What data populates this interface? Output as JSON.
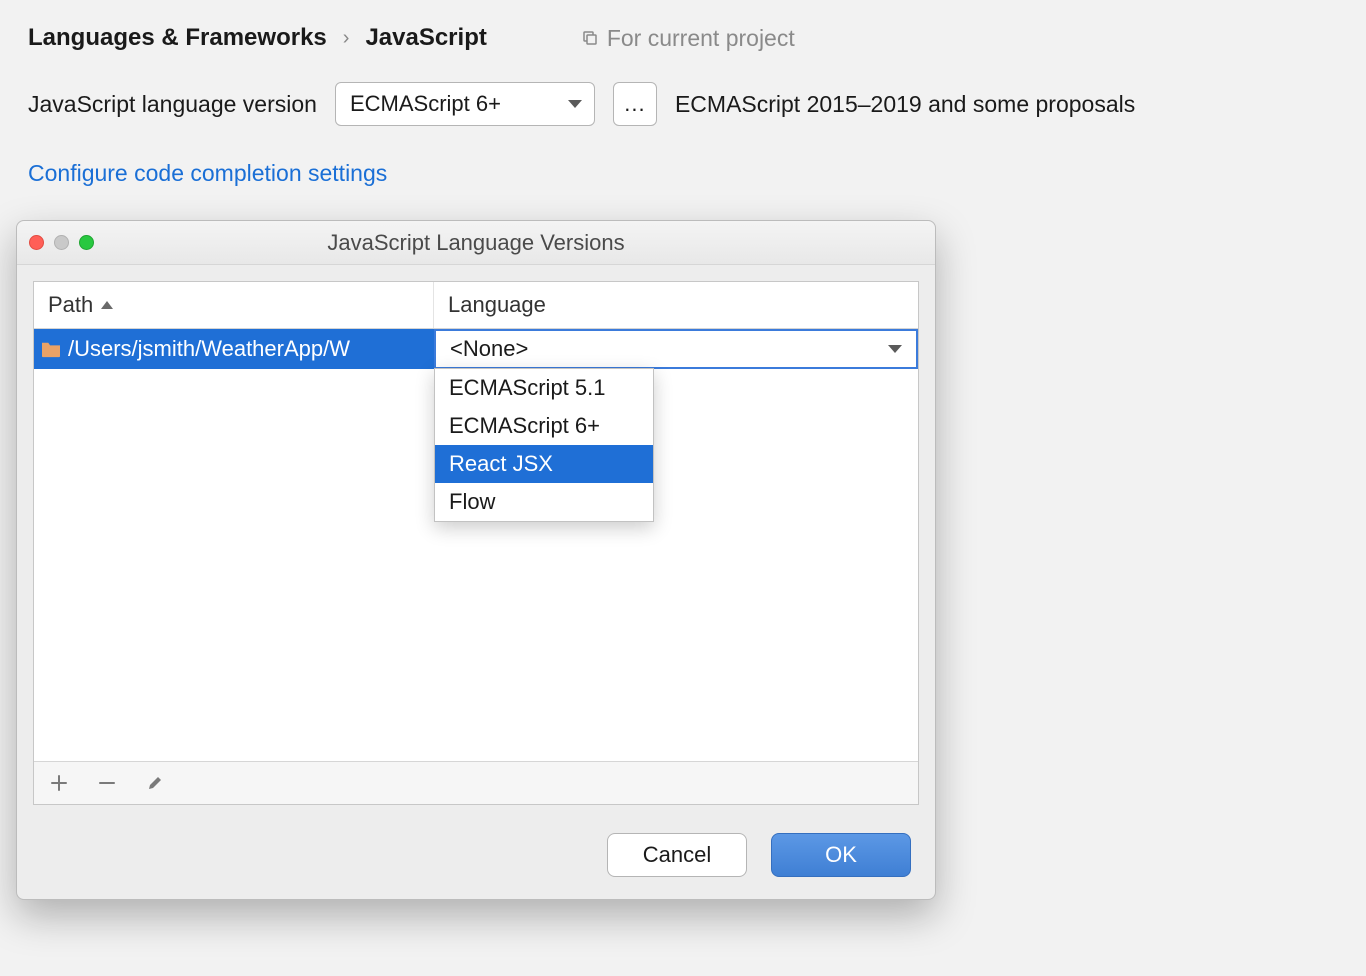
{
  "breadcrumb": {
    "root": "Languages & Frameworks",
    "separator": "›",
    "leaf": "JavaScript"
  },
  "scope_label": "For current project",
  "lang_row": {
    "label": "JavaScript language version",
    "selected": "ECMAScript 6+",
    "ellipsis": "...",
    "hint": "ECMAScript 2015–2019 and some proposals"
  },
  "configure_link": "Configure code completion settings",
  "dialog": {
    "title": "JavaScript Language Versions",
    "columns": {
      "path": "Path",
      "language": "Language"
    },
    "row": {
      "path": "/Users/jsmith/WeatherApp/W",
      "language_selected": "<None>"
    },
    "dropdown_options": [
      "ECMAScript 5.1",
      "ECMAScript 6+",
      "React JSX",
      "Flow"
    ],
    "dropdown_highlighted": "React JSX",
    "buttons": {
      "cancel": "Cancel",
      "ok": "OK"
    }
  }
}
